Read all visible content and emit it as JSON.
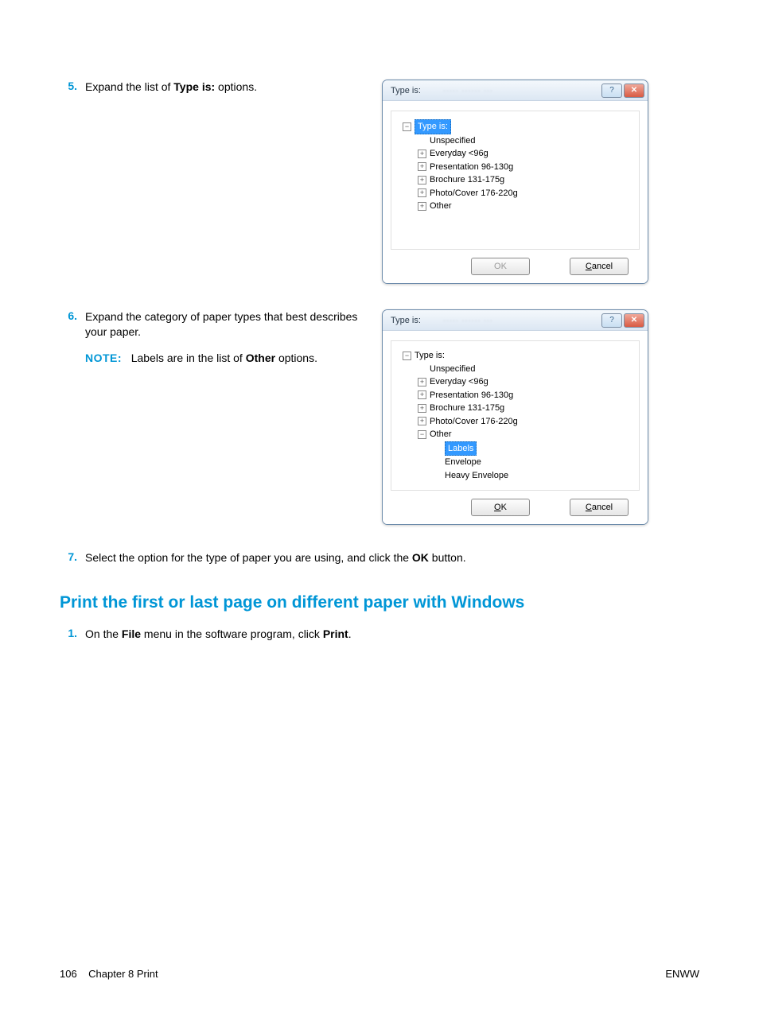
{
  "steps": {
    "s5": {
      "num": "5.",
      "pre": "Expand the list of ",
      "bold": "Type is:",
      "post": " options."
    },
    "s6": {
      "num": "6.",
      "text_a": "Expand the category of paper types that best describes your paper.",
      "note_label": "NOTE:",
      "note_pre": "Labels are in the list of ",
      "note_bold": "Other",
      "note_post": " options."
    },
    "s7": {
      "num": "7.",
      "pre": "Select the option for the type of paper you are using, and click the ",
      "bold": "OK",
      "post": " button."
    },
    "s1_new": {
      "num": "1.",
      "pre1": "On the ",
      "b1": "File",
      "mid": " menu in the software program, click ",
      "b2": "Print",
      "post": "."
    }
  },
  "section_heading": "Print the first or last page on different paper with Windows",
  "dialog": {
    "title": "Type is:",
    "help_glyph": "?",
    "close_glyph": "✕",
    "ok_label": "OK",
    "cancel_label": "Cancel",
    "ok_u": "O",
    "ok_rest": "K",
    "cancel_u": "C",
    "cancel_rest": "ancel"
  },
  "tree1": {
    "root_label": "Type is:",
    "items": [
      {
        "expander": "",
        "label": "Unspecified"
      },
      {
        "expander": "+",
        "label": "Everyday <96g"
      },
      {
        "expander": "+",
        "label": "Presentation 96-130g"
      },
      {
        "expander": "+",
        "label": "Brochure 131-175g"
      },
      {
        "expander": "+",
        "label": "Photo/Cover 176-220g"
      },
      {
        "expander": "+",
        "label": "Other"
      }
    ]
  },
  "tree2": {
    "root_label": "Type is:",
    "items": [
      {
        "expander": "",
        "label": "Unspecified"
      },
      {
        "expander": "+",
        "label": "Everyday <96g"
      },
      {
        "expander": "+",
        "label": "Presentation 96-130g"
      },
      {
        "expander": "+",
        "label": "Brochure 131-175g"
      },
      {
        "expander": "+",
        "label": "Photo/Cover 176-220g"
      },
      {
        "expander": "−",
        "label": "Other"
      }
    ],
    "other_children": [
      {
        "label": "Labels",
        "selected": true
      },
      {
        "label": "Envelope"
      },
      {
        "label": "Heavy Envelope"
      }
    ]
  },
  "footer": {
    "page": "106",
    "chapter": "Chapter 8   Print",
    "right": "ENWW"
  }
}
